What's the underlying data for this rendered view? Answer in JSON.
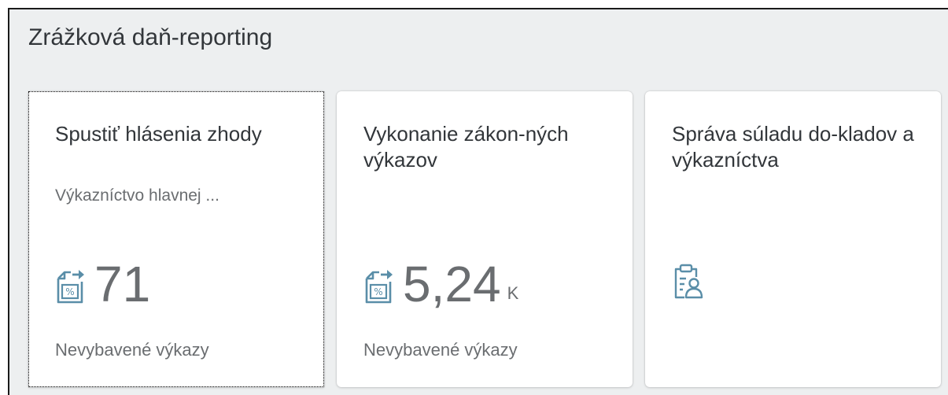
{
  "group": {
    "title": "Zrážková daň-reporting"
  },
  "tiles": [
    {
      "title": "Spustiť hlásenia zhody",
      "subtitle": "Výkazníctvo hlavnej ...",
      "icon": "tax-report-icon",
      "value": "71",
      "scale": "",
      "footer": "Nevybavené výkazy"
    },
    {
      "title": "Vykonanie zákon-ných výkazov",
      "subtitle": "",
      "icon": "tax-report-icon",
      "value": "5,24",
      "scale": "K",
      "footer": "Nevybavené výkazy"
    },
    {
      "title": "Správa súladu do-kladov a výkazníctva",
      "subtitle": "",
      "icon": "clipboard-user-icon",
      "value": "",
      "scale": "",
      "footer": ""
    }
  ],
  "colors": {
    "background": "#edeff0",
    "tile": "#ffffff",
    "title_text": "#32363a",
    "secondary_text": "#6a6d70",
    "icon": "#5a8ea8"
  }
}
